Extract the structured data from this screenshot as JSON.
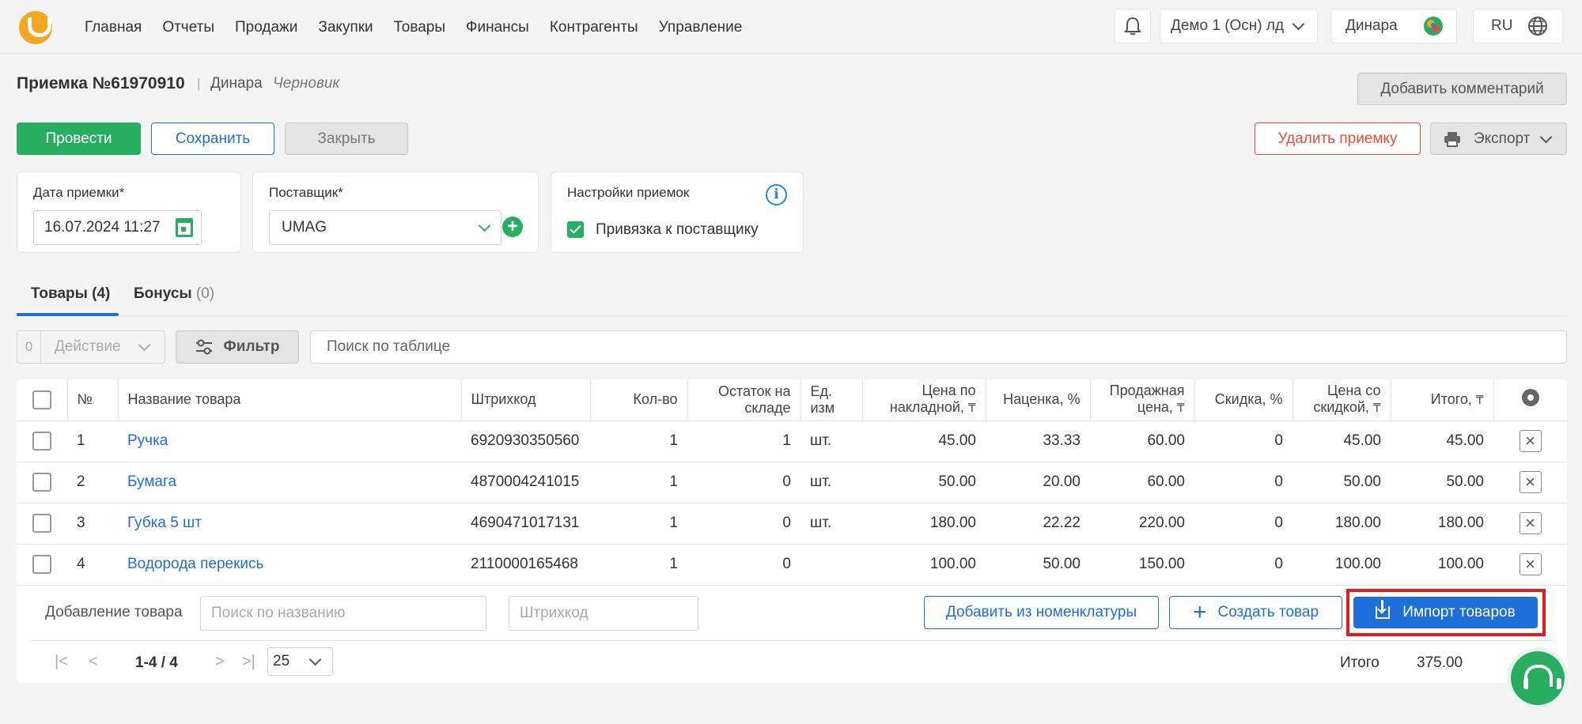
{
  "nav": [
    "Главная",
    "Отчеты",
    "Продажи",
    "Закупки",
    "Товары",
    "Финансы",
    "Контрагенты",
    "Управление"
  ],
  "topbar": {
    "company": "Демо 1 (Осн) лд",
    "user": "Динара",
    "lang": "RU"
  },
  "doc": {
    "title": "Приемка №61970910",
    "separator": "|",
    "user": "Динара",
    "status": "Черновик"
  },
  "buttons": {
    "add_comment": "Добавить комментарий",
    "post": "Провести",
    "save": "Сохранить",
    "close": "Закрыть",
    "delete": "Удалить приемку",
    "export": "Экспорт"
  },
  "cards": {
    "date_label": "Дата приемки*",
    "date_value": "16.07.2024 11:27",
    "supplier_label": "Поставщик*",
    "supplier_value": "UMAG",
    "settings_label": "Настройки приемок",
    "bind_label": "Привязка к поставщику"
  },
  "tabs": {
    "goods": "Товары (4)",
    "bonus_label": "Бонусы",
    "bonus_count": "(0)"
  },
  "toolbar": {
    "selected_count": "0",
    "action": "Действие",
    "filter": "Фильтр",
    "search_placeholder": "Поиск по таблице"
  },
  "table": {
    "headers": {
      "num": "№",
      "name": "Название товара",
      "barcode": "Штрихкод",
      "qty": "Кол-во",
      "stock": "Остаток на складе",
      "unit": "Ед. изм",
      "invoice_price": "Цена по накладной,",
      "markup": "Наценка, %",
      "sale_price": "Продажная цена,",
      "discount": "Скидка, %",
      "discounted_price": "Цена со скидкой,",
      "total": "Итого,",
      "currency": "₸"
    },
    "rows": [
      {
        "num": "1",
        "name": "Ручка",
        "barcode": "6920930350560",
        "qty": "1",
        "stock": "1",
        "unit": "шт.",
        "invoice_price": "45.00",
        "markup": "33.33",
        "sale_price": "60.00",
        "discount": "0",
        "discounted_price": "45.00",
        "total": "45.00"
      },
      {
        "num": "2",
        "name": "Бумага",
        "barcode": "4870004241015",
        "qty": "1",
        "stock": "0",
        "unit": "шт.",
        "invoice_price": "50.00",
        "markup": "20.00",
        "sale_price": "60.00",
        "discount": "0",
        "discounted_price": "50.00",
        "total": "50.00"
      },
      {
        "num": "3",
        "name": "Губка 5 шт",
        "barcode": "4690471017131",
        "qty": "1",
        "stock": "0",
        "unit": "шт.",
        "invoice_price": "180.00",
        "markup": "22.22",
        "sale_price": "220.00",
        "discount": "0",
        "discounted_price": "180.00",
        "total": "180.00"
      },
      {
        "num": "4",
        "name": "Водорода перекись",
        "barcode": "2110000165468",
        "qty": "1",
        "stock": "0",
        "unit": "",
        "invoice_price": "100.00",
        "markup": "50.00",
        "sale_price": "150.00",
        "discount": "0",
        "discounted_price": "100.00",
        "total": "100.00"
      }
    ]
  },
  "add_row": {
    "label": "Добавление товара",
    "name_placeholder": "Поиск по названию",
    "barcode_placeholder": "Штрихкод",
    "from_nomenclature": "Добавить из номенклатуры",
    "create": "Создать товар",
    "import": "Импорт товаров"
  },
  "pagination": {
    "range": "1-4 / 4",
    "per_page": "25"
  },
  "summary": {
    "label": "Итого",
    "value": "375.00"
  },
  "colors": {
    "primary": "#1e6fd9",
    "success": "#27ae60",
    "danger": "#e74c3c",
    "highlight": "#e31b23",
    "logo": "#f5a623"
  }
}
